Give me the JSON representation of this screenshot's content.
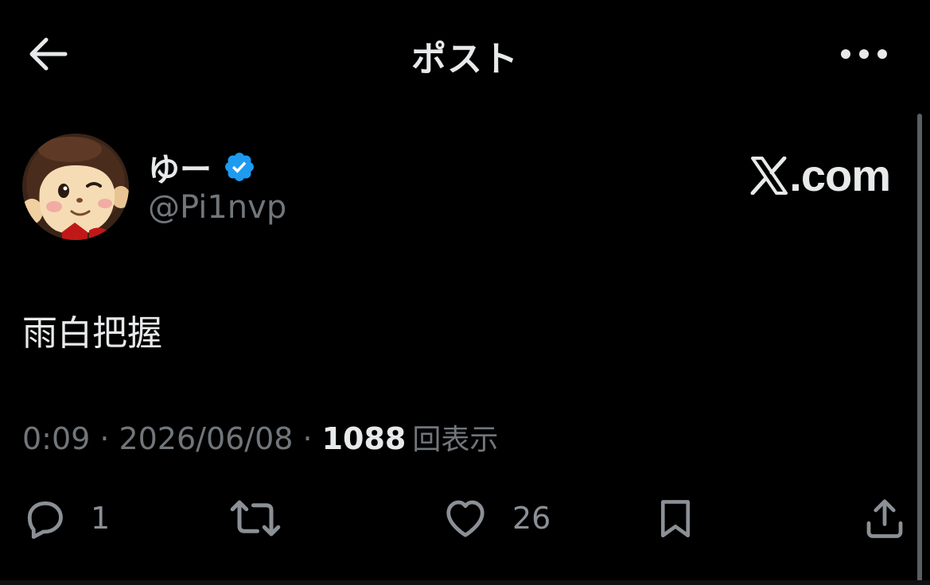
{
  "header": {
    "title": "ポスト",
    "back_icon": "arrow-left-icon",
    "more_icon": "more-horizontal-icon"
  },
  "author": {
    "name": "ゆー",
    "handle": "@Pi1nvp",
    "verified": true,
    "verified_color": "#1d9bf0"
  },
  "watermark": {
    "text": ".com",
    "logo": "x-logo-icon"
  },
  "post": {
    "text": "雨白把握"
  },
  "meta": {
    "time": "0:09",
    "separator": "·",
    "date": "2026/06/08",
    "views_count": "1088",
    "views_label": "回表示"
  },
  "actions": {
    "reply_count": "1",
    "repost_count": "",
    "like_count": "26",
    "bookmark_count": "",
    "share_count": ""
  },
  "colors": {
    "background": "#000000",
    "primary_text": "#e7e9ea",
    "secondary_text": "#71767b",
    "accent": "#1d9bf0"
  }
}
